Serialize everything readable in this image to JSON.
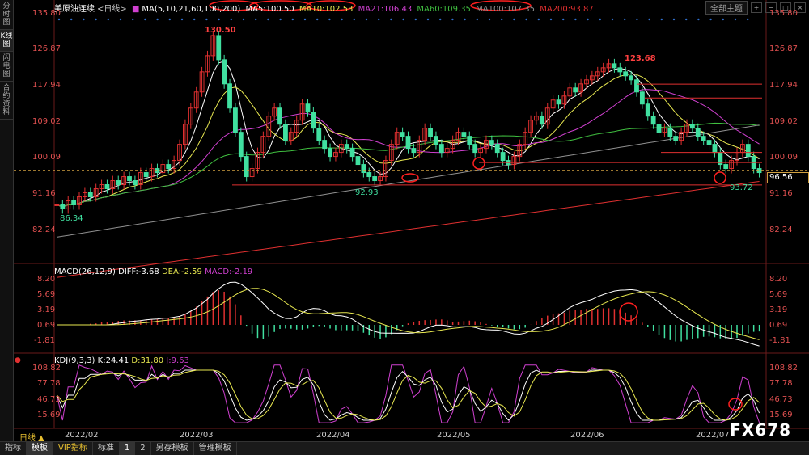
{
  "sidebar": {
    "tabs": [
      {
        "label": "分时图"
      },
      {
        "label": "K线图"
      },
      {
        "label": "闪电图"
      },
      {
        "label": "合约资料"
      }
    ]
  },
  "header": {
    "instrument": "美原油连续",
    "period": "<日线>",
    "ma_params": "MA(5,10,21,60,100,200)",
    "ma5": "MA5:100.50",
    "ma10": "MA10:102.53",
    "ma21": "MA21:106.43",
    "ma60": "MA60:109.35",
    "ma100": "MA100:107.35",
    "ma200": "MA200:93.87",
    "theme_button": "全部主题"
  },
  "colors": {
    "ma5": "#ffffff",
    "ma10": "#e8e850",
    "ma21": "#d040d0",
    "ma60": "#40c040",
    "ma100": "#909090",
    "ma200": "#e03030",
    "up": "#e03030",
    "down": "#40e0a0",
    "axis": "#e05050"
  },
  "price_axis": {
    "labels": [
      "135.80",
      "126.87",
      "117.94",
      "109.02",
      "100.09",
      "91.16",
      "82.24"
    ],
    "current": "96.56"
  },
  "annotations": {
    "high1": "130.50",
    "high2": "123.68",
    "low1": "86.34",
    "low2": "92.93",
    "low3": "93.72"
  },
  "macd": {
    "title": "MACD(26,12,9)",
    "diff": "DIFF:-3.68",
    "dea": "DEA:-2.59",
    "macd": "MACD:-2.19",
    "labels": [
      "8.20",
      "5.69",
      "3.19",
      "0.69",
      "-1.81"
    ]
  },
  "kdj": {
    "title": "KDJ(9,3,3)",
    "k": "K:24.41",
    "d": "D:31.80",
    "j": "J:9.63",
    "labels": [
      "108.82",
      "77.78",
      "46.73",
      "15.69"
    ]
  },
  "time_axis": {
    "period": "日线 ▲",
    "labels": [
      "2022/02",
      "2022/03",
      "2022/04",
      "2022/05",
      "2022/06",
      "2022/07"
    ]
  },
  "bottom_tabs": [
    "指标",
    "模板",
    "VIP指标",
    "标准",
    "1",
    "2",
    "另存模板",
    "管理模板"
  ],
  "watermark": "FX678"
}
